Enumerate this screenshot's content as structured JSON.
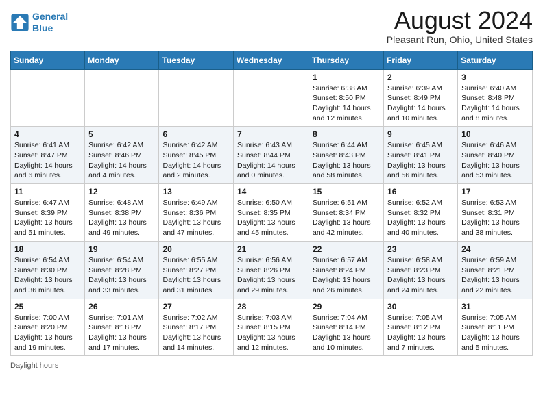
{
  "logo": {
    "line1": "General",
    "line2": "Blue"
  },
  "title": "August 2024",
  "subtitle": "Pleasant Run, Ohio, United States",
  "weekdays": [
    "Sunday",
    "Monday",
    "Tuesday",
    "Wednesday",
    "Thursday",
    "Friday",
    "Saturday"
  ],
  "weeks": [
    [
      {
        "day": "",
        "info": ""
      },
      {
        "day": "",
        "info": ""
      },
      {
        "day": "",
        "info": ""
      },
      {
        "day": "",
        "info": ""
      },
      {
        "day": "1",
        "info": "Sunrise: 6:38 AM\nSunset: 8:50 PM\nDaylight: 14 hours and 12 minutes."
      },
      {
        "day": "2",
        "info": "Sunrise: 6:39 AM\nSunset: 8:49 PM\nDaylight: 14 hours and 10 minutes."
      },
      {
        "day": "3",
        "info": "Sunrise: 6:40 AM\nSunset: 8:48 PM\nDaylight: 14 hours and 8 minutes."
      }
    ],
    [
      {
        "day": "4",
        "info": "Sunrise: 6:41 AM\nSunset: 8:47 PM\nDaylight: 14 hours and 6 minutes."
      },
      {
        "day": "5",
        "info": "Sunrise: 6:42 AM\nSunset: 8:46 PM\nDaylight: 14 hours and 4 minutes."
      },
      {
        "day": "6",
        "info": "Sunrise: 6:42 AM\nSunset: 8:45 PM\nDaylight: 14 hours and 2 minutes."
      },
      {
        "day": "7",
        "info": "Sunrise: 6:43 AM\nSunset: 8:44 PM\nDaylight: 14 hours and 0 minutes."
      },
      {
        "day": "8",
        "info": "Sunrise: 6:44 AM\nSunset: 8:43 PM\nDaylight: 13 hours and 58 minutes."
      },
      {
        "day": "9",
        "info": "Sunrise: 6:45 AM\nSunset: 8:41 PM\nDaylight: 13 hours and 56 minutes."
      },
      {
        "day": "10",
        "info": "Sunrise: 6:46 AM\nSunset: 8:40 PM\nDaylight: 13 hours and 53 minutes."
      }
    ],
    [
      {
        "day": "11",
        "info": "Sunrise: 6:47 AM\nSunset: 8:39 PM\nDaylight: 13 hours and 51 minutes."
      },
      {
        "day": "12",
        "info": "Sunrise: 6:48 AM\nSunset: 8:38 PM\nDaylight: 13 hours and 49 minutes."
      },
      {
        "day": "13",
        "info": "Sunrise: 6:49 AM\nSunset: 8:36 PM\nDaylight: 13 hours and 47 minutes."
      },
      {
        "day": "14",
        "info": "Sunrise: 6:50 AM\nSunset: 8:35 PM\nDaylight: 13 hours and 45 minutes."
      },
      {
        "day": "15",
        "info": "Sunrise: 6:51 AM\nSunset: 8:34 PM\nDaylight: 13 hours and 42 minutes."
      },
      {
        "day": "16",
        "info": "Sunrise: 6:52 AM\nSunset: 8:32 PM\nDaylight: 13 hours and 40 minutes."
      },
      {
        "day": "17",
        "info": "Sunrise: 6:53 AM\nSunset: 8:31 PM\nDaylight: 13 hours and 38 minutes."
      }
    ],
    [
      {
        "day": "18",
        "info": "Sunrise: 6:54 AM\nSunset: 8:30 PM\nDaylight: 13 hours and 36 minutes."
      },
      {
        "day": "19",
        "info": "Sunrise: 6:54 AM\nSunset: 8:28 PM\nDaylight: 13 hours and 33 minutes."
      },
      {
        "day": "20",
        "info": "Sunrise: 6:55 AM\nSunset: 8:27 PM\nDaylight: 13 hours and 31 minutes."
      },
      {
        "day": "21",
        "info": "Sunrise: 6:56 AM\nSunset: 8:26 PM\nDaylight: 13 hours and 29 minutes."
      },
      {
        "day": "22",
        "info": "Sunrise: 6:57 AM\nSunset: 8:24 PM\nDaylight: 13 hours and 26 minutes."
      },
      {
        "day": "23",
        "info": "Sunrise: 6:58 AM\nSunset: 8:23 PM\nDaylight: 13 hours and 24 minutes."
      },
      {
        "day": "24",
        "info": "Sunrise: 6:59 AM\nSunset: 8:21 PM\nDaylight: 13 hours and 22 minutes."
      }
    ],
    [
      {
        "day": "25",
        "info": "Sunrise: 7:00 AM\nSunset: 8:20 PM\nDaylight: 13 hours and 19 minutes."
      },
      {
        "day": "26",
        "info": "Sunrise: 7:01 AM\nSunset: 8:18 PM\nDaylight: 13 hours and 17 minutes."
      },
      {
        "day": "27",
        "info": "Sunrise: 7:02 AM\nSunset: 8:17 PM\nDaylight: 13 hours and 14 minutes."
      },
      {
        "day": "28",
        "info": "Sunrise: 7:03 AM\nSunset: 8:15 PM\nDaylight: 13 hours and 12 minutes."
      },
      {
        "day": "29",
        "info": "Sunrise: 7:04 AM\nSunset: 8:14 PM\nDaylight: 13 hours and 10 minutes."
      },
      {
        "day": "30",
        "info": "Sunrise: 7:05 AM\nSunset: 8:12 PM\nDaylight: 13 hours and 7 minutes."
      },
      {
        "day": "31",
        "info": "Sunrise: 7:05 AM\nSunset: 8:11 PM\nDaylight: 13 hours and 5 minutes."
      }
    ]
  ],
  "footer": "Daylight hours"
}
